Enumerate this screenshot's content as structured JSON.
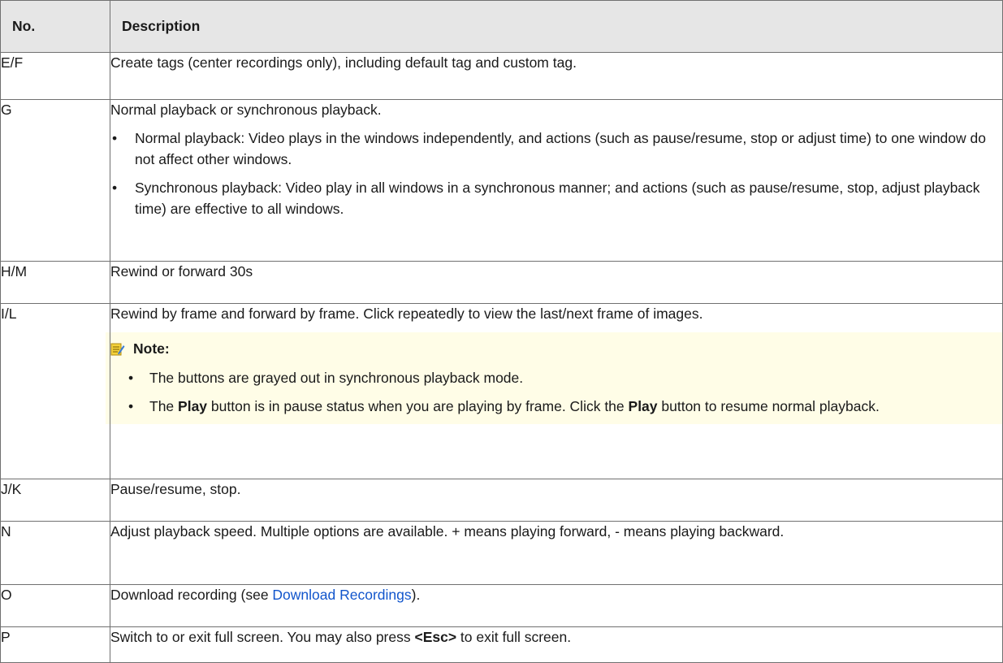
{
  "header": {
    "no": "No.",
    "description": "Description"
  },
  "rows": {
    "ef": {
      "no": "E/F",
      "desc": "Create tags (center recordings only), including default tag and custom tag."
    },
    "g": {
      "no": "G",
      "desc": "Normal playback or synchronous playback.",
      "bullet1": "Normal playback: Video plays in the windows independently, and actions (such as pause/resume, stop or adjust time) to one window do not affect other windows.",
      "bullet2": "Synchronous playback: Video play in all windows in a synchronous manner; and actions (such as pause/resume, stop, adjust playback time) are effective to all windows."
    },
    "hm": {
      "no": "H/M",
      "desc": "Rewind or forward 30s"
    },
    "il": {
      "no": "I/L",
      "desc": "Rewind by frame and forward by frame. Click repeatedly to view the last/next frame of images.",
      "note_label": "Note:",
      "note1": "The buttons are grayed out in synchronous playback mode.",
      "note2_a": "The ",
      "note2_b1": "Play",
      "note2_c": " button is in pause status when you are playing by frame. Click the ",
      "note2_b2": "Play",
      "note2_d": " button to resume normal playback."
    },
    "jk": {
      "no": "J/K",
      "desc": "Pause/resume, stop."
    },
    "n": {
      "no": "N",
      "desc": "Adjust playback speed. Multiple options are available. + means playing forward, - means playing backward."
    },
    "o": {
      "no": "O",
      "desc_a": "Download recording (see ",
      "link": "Download Recordings",
      "desc_b": ")."
    },
    "p": {
      "no": "P",
      "desc_a": "Switch to or exit full screen. You may also press ",
      "key": "<Esc>",
      "desc_b": " to exit full screen."
    }
  },
  "bullet_char": "•",
  "icons": {
    "note": "note-icon"
  },
  "colors": {
    "header_bg": "#e6e6e6",
    "note_bg": "#fffde7",
    "link": "#1155cc",
    "border": "#707070"
  }
}
